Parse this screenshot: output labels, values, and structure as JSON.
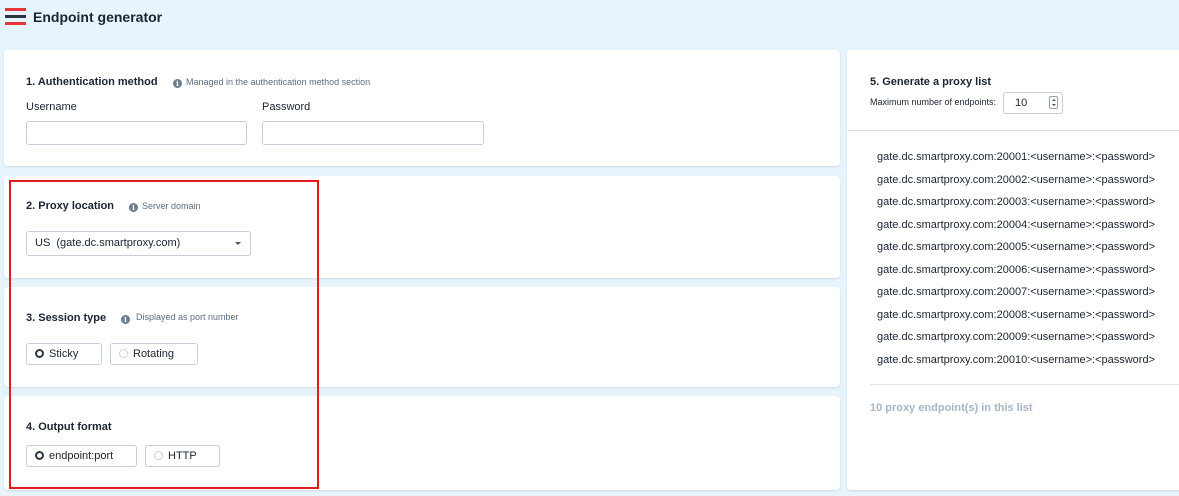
{
  "app": {
    "title": "Endpoint generator",
    "logo_icon": "stripes-flag-logo-icon",
    "logo_colors": [
      "#e8343f",
      "#2b3442",
      "#e8343f"
    ]
  },
  "auth": {
    "title": "1. Authentication method",
    "info": "Managed in the authentication method section",
    "username_label": "Username",
    "username_value": "",
    "password_label": "Password",
    "password_value": ""
  },
  "location": {
    "title": "2. Proxy location",
    "info": "Server domain",
    "selected": "US  (gate.dc.smartproxy.com)"
  },
  "session": {
    "title": "3. Session type",
    "info": "Displayed as port number",
    "options": [
      "Sticky",
      "Rotating"
    ],
    "selected": "Sticky"
  },
  "output": {
    "title": "4. Output format",
    "options": [
      "endpoint:port",
      "HTTP"
    ],
    "selected": "endpoint:port"
  },
  "proxy_list": {
    "title": "5. Generate a proxy list",
    "max_label": "Maximum number of endpoints:",
    "max_value": "10",
    "endpoints": [
      "gate.dc.smartproxy.com:20001:<username>:<password>",
      "gate.dc.smartproxy.com:20002:<username>:<password>",
      "gate.dc.smartproxy.com:20003:<username>:<password>",
      "gate.dc.smartproxy.com:20004:<username>:<password>",
      "gate.dc.smartproxy.com:20005:<username>:<password>",
      "gate.dc.smartproxy.com:20006:<username>:<password>",
      "gate.dc.smartproxy.com:20007:<username>:<password>",
      "gate.dc.smartproxy.com:20008:<username>:<password>",
      "gate.dc.smartproxy.com:20009:<username>:<password>",
      "gate.dc.smartproxy.com:20010:<username>:<password>"
    ],
    "count_text": "10 proxy endpoint(s) in this list"
  },
  "colors": {
    "background": "#e8f4fb",
    "highlight_border": "#e31b1b",
    "muted_text": "#a8b6c6"
  }
}
